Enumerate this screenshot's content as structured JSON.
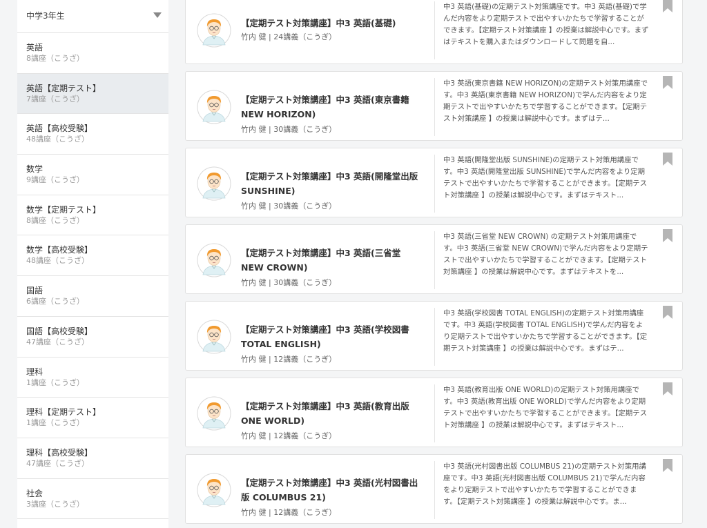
{
  "sidebar": {
    "grade": "中学3年生",
    "items": [
      {
        "name": "英語",
        "count": "8講座（こうざ）",
        "active": false
      },
      {
        "name": "英語【定期テスト】",
        "count": "7講座（こうざ）",
        "active": true
      },
      {
        "name": "英語【高校受験】",
        "count": "48講座（こうざ）",
        "active": false
      },
      {
        "name": "数学",
        "count": "9講座（こうざ）",
        "active": false
      },
      {
        "name": "数学【定期テスト】",
        "count": "8講座（こうざ）",
        "active": false
      },
      {
        "name": "数学【高校受験】",
        "count": "48講座（こうざ）",
        "active": false
      },
      {
        "name": "国語",
        "count": "6講座（こうざ）",
        "active": false
      },
      {
        "name": "国語【高校受験】",
        "count": "47講座（こうざ）",
        "active": false
      },
      {
        "name": "理科",
        "count": "1講座（こうざ）",
        "active": false
      },
      {
        "name": "理科【定期テスト】",
        "count": "1講座（こうざ）",
        "active": false
      },
      {
        "name": "理科【高校受験】",
        "count": "47講座（こうざ）",
        "active": false
      },
      {
        "name": "社会",
        "count": "3講座（こうざ）",
        "active": false
      }
    ]
  },
  "courses": [
    {
      "title_line1": "【定期テスト対策講座】中3 英語(基礎)",
      "title_line2": "",
      "meta": "竹内 健 | 24講義（こうぎ）",
      "description": "中3 英語(基礎)の定期テスト対策講座です。中3 英語(基礎)で学んだ内容をより定期テストで出やすいかたちで学習することができます。【定期テスト対策講座 】の授業は解説中心です。まずはテキストを購入またはダウンロードして問題を自..."
    },
    {
      "title_line1": "【定期テスト対策講座】中3 英語(東京書籍",
      "title_line2": "NEW HORIZON)",
      "meta": "竹内 健 | 30講義（こうぎ）",
      "description": "中3 英語(東京書籍 NEW HORIZON)の定期テスト対策用講座です。中3 英語(東京書籍 NEW HORIZON)で学んだ内容をより定期テストで出やすいかたちで学習することができます。【定期テスト対策講座 】の授業は解説中心です。まずはテ..."
    },
    {
      "title_line1": "【定期テスト対策講座】中3 英語(開隆堂出版",
      "title_line2": "SUNSHINE)",
      "meta": "竹内 健 | 30講義（こうぎ）",
      "description": "中3 英語(開隆堂出版 SUNSHINE)の定期テスト対策用講座です。中3 英語(開隆堂出版 SUNSHINE)で学んだ内容をより定期テストで出やすいかたちで学習することができます。【定期テスト対策講座 】の授業は解説中心です。まずはテキスト..."
    },
    {
      "title_line1": "【定期テスト対策講座】中3 英語(三省堂",
      "title_line2": "NEW CROWN)",
      "meta": "竹内 健 | 30講義（こうぎ）",
      "description": "中3 英語(三省堂 NEW CROWN) の定期テスト対策用講座です。中3 英語(三省堂 NEW CROWN)で学んだ内容をより定期テストで出やすいかたちで学習することができます。【定期テスト対策講座 】の授業は解説中心です。まずはテキストを..."
    },
    {
      "title_line1": "【定期テスト対策講座】中3 英語(学校図書",
      "title_line2": "TOTAL ENGLISH)",
      "meta": "竹内 健 | 12講義（こうぎ）",
      "description": "中3 英語(学校図書 TOTAL ENGLISH)の定期テスト対策用講座です。中3 英語(学校図書 TOTAL ENGLISH)で学んだ内容をより定期テストで出やすいかたちで学習することができます。【定期テスト対策講座 】の授業は解説中心です。まずはテ..."
    },
    {
      "title_line1": "【定期テスト対策講座】中3 英語(教育出版",
      "title_line2": "ONE WORLD)",
      "meta": "竹内 健 | 12講義（こうぎ）",
      "description": "中3 英語(教育出版 ONE WORLD)の定期テスト対策用講座です。中3 英語(教育出版 ONE WORLD)で学んだ内容をより定期テストで出やすいかたちで学習することができます。【定期テスト対策講座 】の授業は解説中心です。まずはテキスト..."
    },
    {
      "title_line1": "【定期テスト対策講座】中3 英語(光村図書出",
      "title_line2": "版 COLUMBUS 21)",
      "meta": "竹内 健 | 12講義（こうぎ）",
      "description": "中3 英語(光村図書出版 COLUMBUS 21)の定期テスト対策用講座です。中3 英語(光村図書出版 COLUMBUS 21)で学んだ内容をより定期テストで出やすいかたちで学習することができます。【定期テスト対策講座 】の授業は解説中心です。ま..."
    }
  ],
  "icons": {
    "avatar": "teacher-avatar-icon",
    "bookmark": "bookmark-icon",
    "dropdown": "chevron-down-icon"
  },
  "colors": {
    "page_bg": "#f4f5f6",
    "active_item_bg": "#e9ecef",
    "bookmark": "#b5b5b5"
  }
}
